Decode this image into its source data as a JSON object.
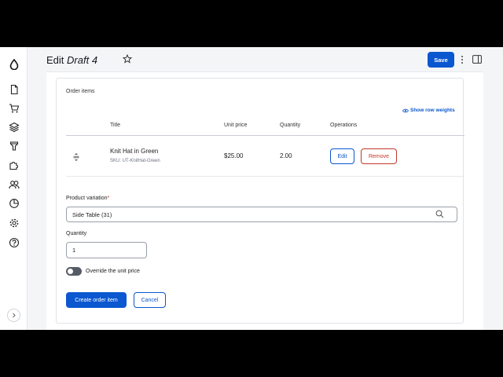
{
  "header": {
    "title_prefix": "Edit",
    "title_name": "Draft 4",
    "save_label": "Save"
  },
  "order_items": {
    "section_title": "Order items",
    "row_weights_label": "Show row weights",
    "columns": [
      "Title",
      "Unit price",
      "Quantity",
      "Operations"
    ],
    "rows": [
      {
        "title": "Knit Hat in Green",
        "sku": "SKU: UT-KnitHat-Green",
        "unit_price": "$25.00",
        "quantity": "2.00",
        "edit_label": "Edit",
        "remove_label": "Remove"
      }
    ]
  },
  "form": {
    "variation_label": "Product variation",
    "variation_required_mark": "*",
    "variation_value": "Side Table (31)",
    "quantity_label": "Quantity",
    "quantity_value": "1",
    "override_label": "Override the unit price",
    "override_enabled": false,
    "create_label": "Create order item",
    "cancel_label": "Cancel"
  },
  "icons": {
    "sidebar": [
      "drop-logo-icon",
      "document-icon",
      "cart-icon",
      "layers-icon",
      "funnel-icon",
      "puzzle-icon",
      "users-icon",
      "pie-chart-icon",
      "gear-icon",
      "help-icon"
    ],
    "sidebar_expand": "chevron-right-icon",
    "title_star": "star-icon",
    "more": "kebab-icon",
    "panel": "sidebar-panel-icon",
    "row_weights": "eye-icon",
    "drag": "drag-handle-icon",
    "search": "search-icon"
  },
  "colors": {
    "primary": "#0b57d0",
    "danger": "#c0392b",
    "toggle_off": "#555b66"
  }
}
